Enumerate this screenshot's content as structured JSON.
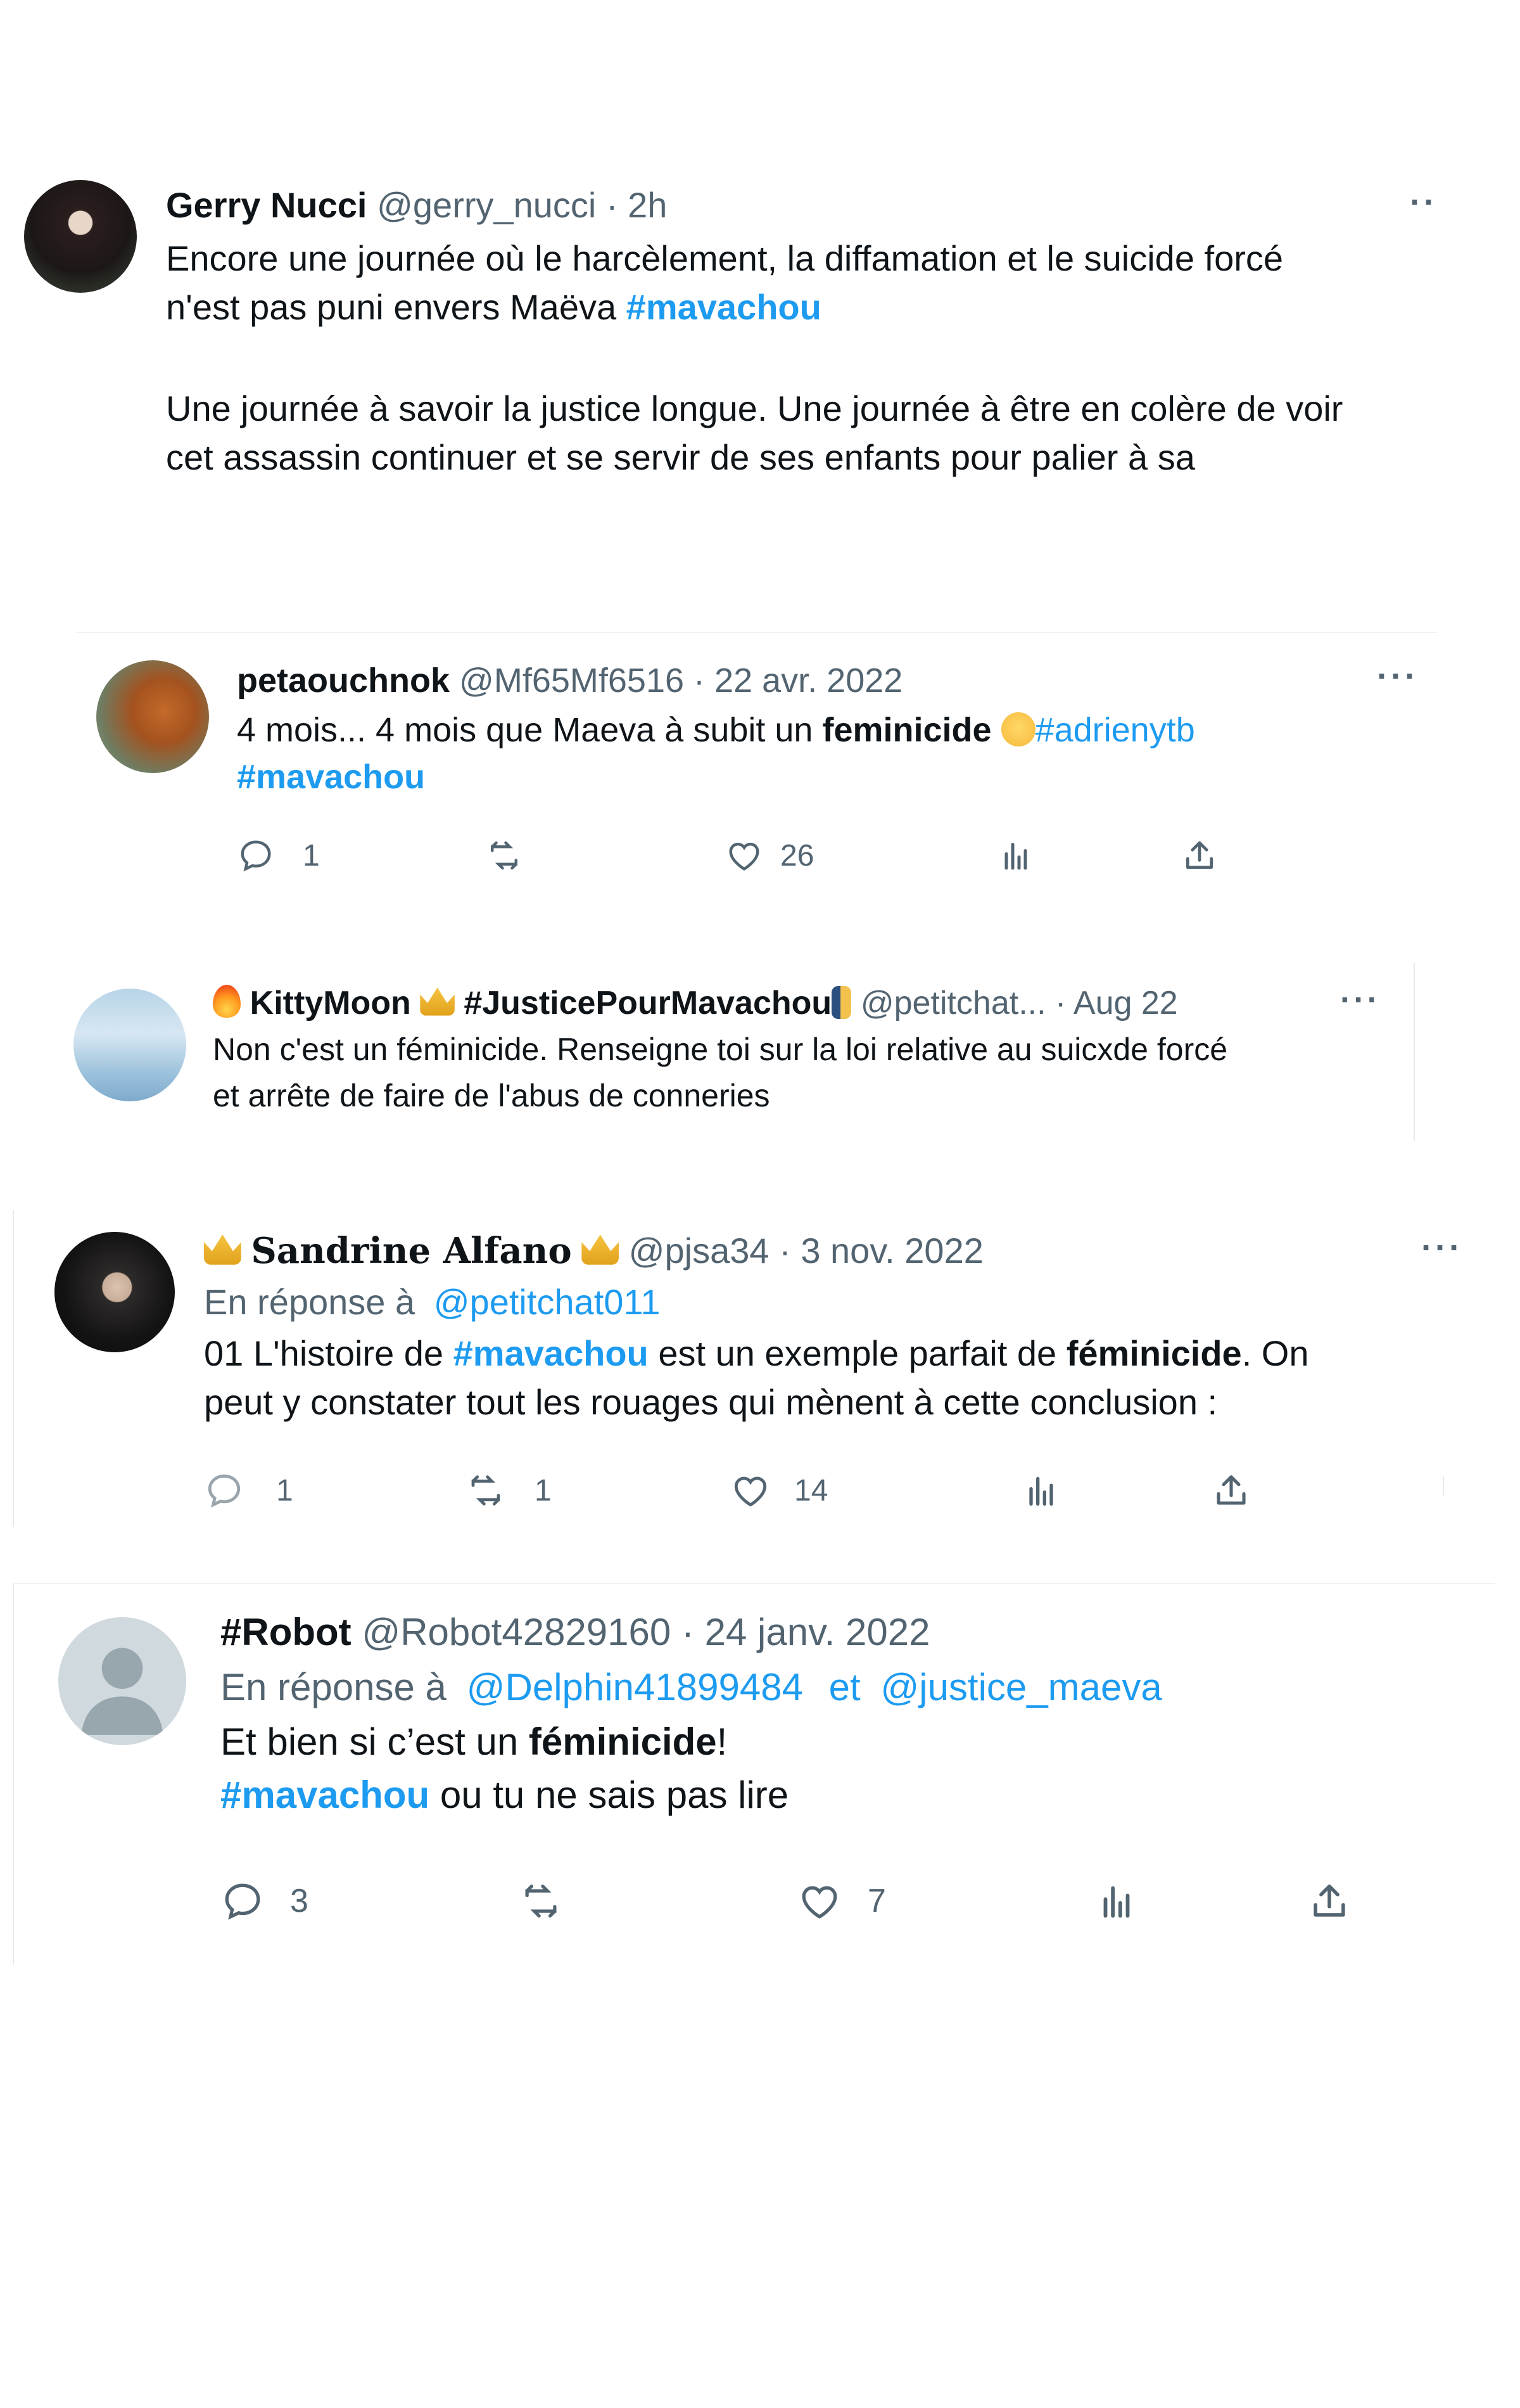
{
  "tweets": [
    {
      "name": "Gerry Nucci",
      "handle": "@gerry_nucci",
      "separator": "·",
      "time": "2h",
      "text_line1": "Encore une journée où le harcèlement, la diffamation et le suicide forcé",
      "text_line2_plain": "n'est pas puni envers Maëva ",
      "text_line2_hashtag": "#mavachou",
      "text_para2_line1": "Une journée à savoir la justice longue. Une journée à être en colère de voir",
      "text_para2_line2": "cet assassin continuer et se servir de ses enfants pour palier à sa",
      "more": "··"
    },
    {
      "name": "petaouchnok",
      "handle": "@Mf65Mf6516",
      "separator": "·",
      "time": "22 avr. 2022",
      "text_plain1": "4 mois... 4 mois que Maeva à subit un ",
      "text_bold": "feminicide",
      "text_hashtag1": "#adrienytb",
      "text_hashtag2": "#mavachou",
      "more": "···",
      "counts": {
        "replies": "1",
        "retweets": "",
        "likes": "26"
      }
    },
    {
      "name": "KittyMoon",
      "name_tag": "#JusticePourMavachou",
      "handle": "@petitchat...",
      "separator": "·",
      "time": "Aug 22",
      "text_line1": "Non c'est un féminicide. Renseigne toi sur la loi relative au suicxde forcé",
      "text_line2": "et arrête de faire de l'abus de conneries",
      "more": "···"
    },
    {
      "name": "Sandrine Alfano",
      "handle": "@pjsa34",
      "separator": "·",
      "time": "3 nov. 2022",
      "reply_label": "En réponse à",
      "reply_handle": "@petitchat011",
      "text_plain1": "01 L'histoire de ",
      "text_hashtag": "#mavachou",
      "text_plain2": " est un exemple parfait de ",
      "text_bold": "féminicide",
      "text_plain3": ". On",
      "text_line2": "peut y constater tout les rouages qui mènent à cette conclusion :",
      "more": "···",
      "counts": {
        "replies": "1",
        "retweets": "1",
        "likes": "14"
      }
    },
    {
      "name": "#Robot",
      "handle": "@Robot42829160",
      "separator": "·",
      "time": "24 janv. 2022",
      "reply_label": "En réponse à",
      "reply_handle1": "@Delphin41899484",
      "reply_and": "et",
      "reply_handle2": "@justice_maeva",
      "text_plain1": "Et bien si c’est un ",
      "text_bold": "féminicide",
      "text_plain2": "!",
      "text_hashtag": "#mavachou",
      "text_plain3": " ou tu ne sais pas lire",
      "counts": {
        "replies": "3",
        "retweets": "",
        "likes": "7"
      }
    }
  ],
  "icons": {
    "reply": "reply-icon",
    "retweet": "retweet-icon",
    "like": "heart-icon",
    "views": "analytics-icon",
    "share": "share-icon"
  },
  "colors": {
    "link": "#1d9bf0",
    "muted": "#536471",
    "text": "#0f1419"
  }
}
